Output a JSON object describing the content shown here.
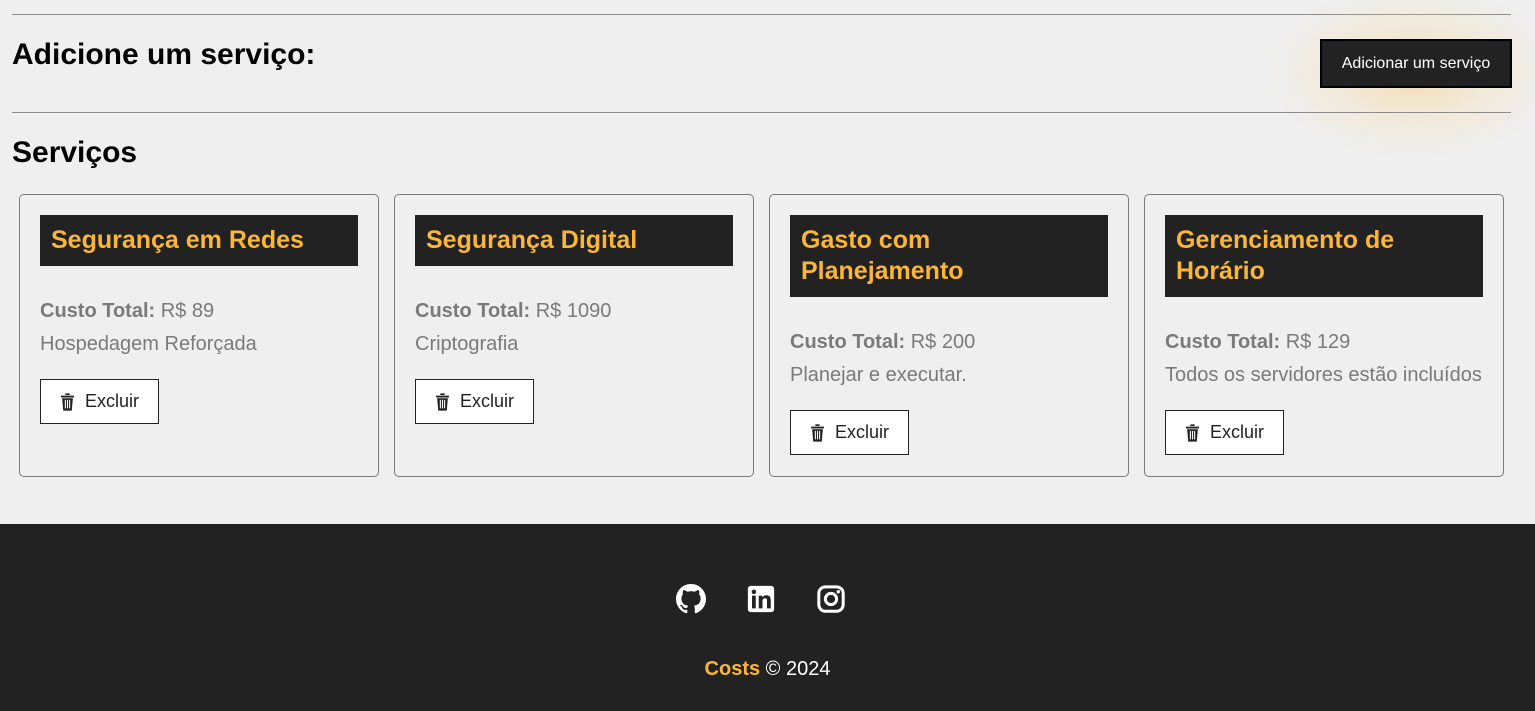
{
  "header": {
    "add_title": "Adicione um serviço:",
    "add_button_label": "Adicionar um serviço"
  },
  "services": {
    "title": "Serviços",
    "cost_label": "Custo Total:",
    "delete_label": "Excluir",
    "items": [
      {
        "name": "Segurança em Redes",
        "cost": "R$ 89",
        "description": "Hospedagem Reforçada"
      },
      {
        "name": "Segurança Digital",
        "cost": "R$ 1090",
        "description": "Criptografia"
      },
      {
        "name": "Gasto com Planejamento",
        "cost": "R$ 200",
        "description": "Planejar e executar."
      },
      {
        "name": "Gerenciamento de Horário",
        "cost": "R$ 129",
        "description": "Todos os servidores estão incluídos"
      }
    ]
  },
  "footer": {
    "icons": [
      "github-icon",
      "linkedin-icon",
      "instagram-icon"
    ],
    "brand": "Costs",
    "copyright": " © 2024"
  },
  "colors": {
    "accent": "#fbb537",
    "dark": "#222222",
    "background": "#efefef"
  }
}
